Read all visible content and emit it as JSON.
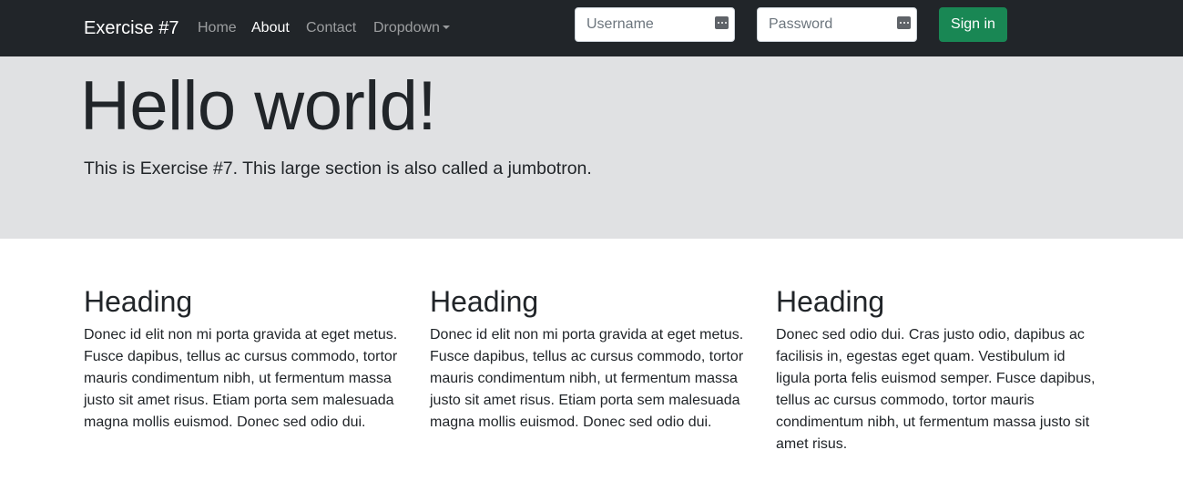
{
  "navbar": {
    "brand": "Exercise #7",
    "links": [
      {
        "label": "Home",
        "active": false
      },
      {
        "label": "About",
        "active": true
      },
      {
        "label": "Contact",
        "active": false
      },
      {
        "label": "Dropdown",
        "active": false
      }
    ],
    "username": {
      "placeholder": "Username",
      "value": ""
    },
    "password": {
      "placeholder": "Password",
      "value": ""
    },
    "signin_label": "Sign in",
    "colors": {
      "background": "#212529",
      "button": "#198754"
    }
  },
  "jumbotron": {
    "title": "Hello world!",
    "lead": "This is Exercise #7. This large section is also called a jumbotron.",
    "background": "#e0e1e3"
  },
  "columns": [
    {
      "heading": "Heading",
      "text": "Donec id elit non mi porta gravida at eget metus. Fusce dapibus, tellus ac cursus commodo, tortor mauris condimentum nibh, ut fermentum massa justo sit amet risus. Etiam porta sem malesuada magna mollis euismod. Donec sed odio dui."
    },
    {
      "heading": "Heading",
      "text": "Donec id elit non mi porta gravida at eget metus. Fusce dapibus, tellus ac cursus commodo, tortor mauris condimentum nibh, ut fermentum massa justo sit amet risus. Etiam porta sem malesuada magna mollis euismod. Donec sed odio dui."
    },
    {
      "heading": "Heading",
      "text": "Donec sed odio dui. Cras justo odio, dapibus ac facilisis in, egestas eget quam. Vestibulum id ligula porta felis euismod semper. Fusce dapibus, tellus ac cursus commodo, tortor mauris condimentum nibh, ut fermentum massa justo sit amet risus."
    }
  ],
  "icons": {
    "password_manager": "password-key-icon",
    "dropdown": "caret-down-icon"
  }
}
